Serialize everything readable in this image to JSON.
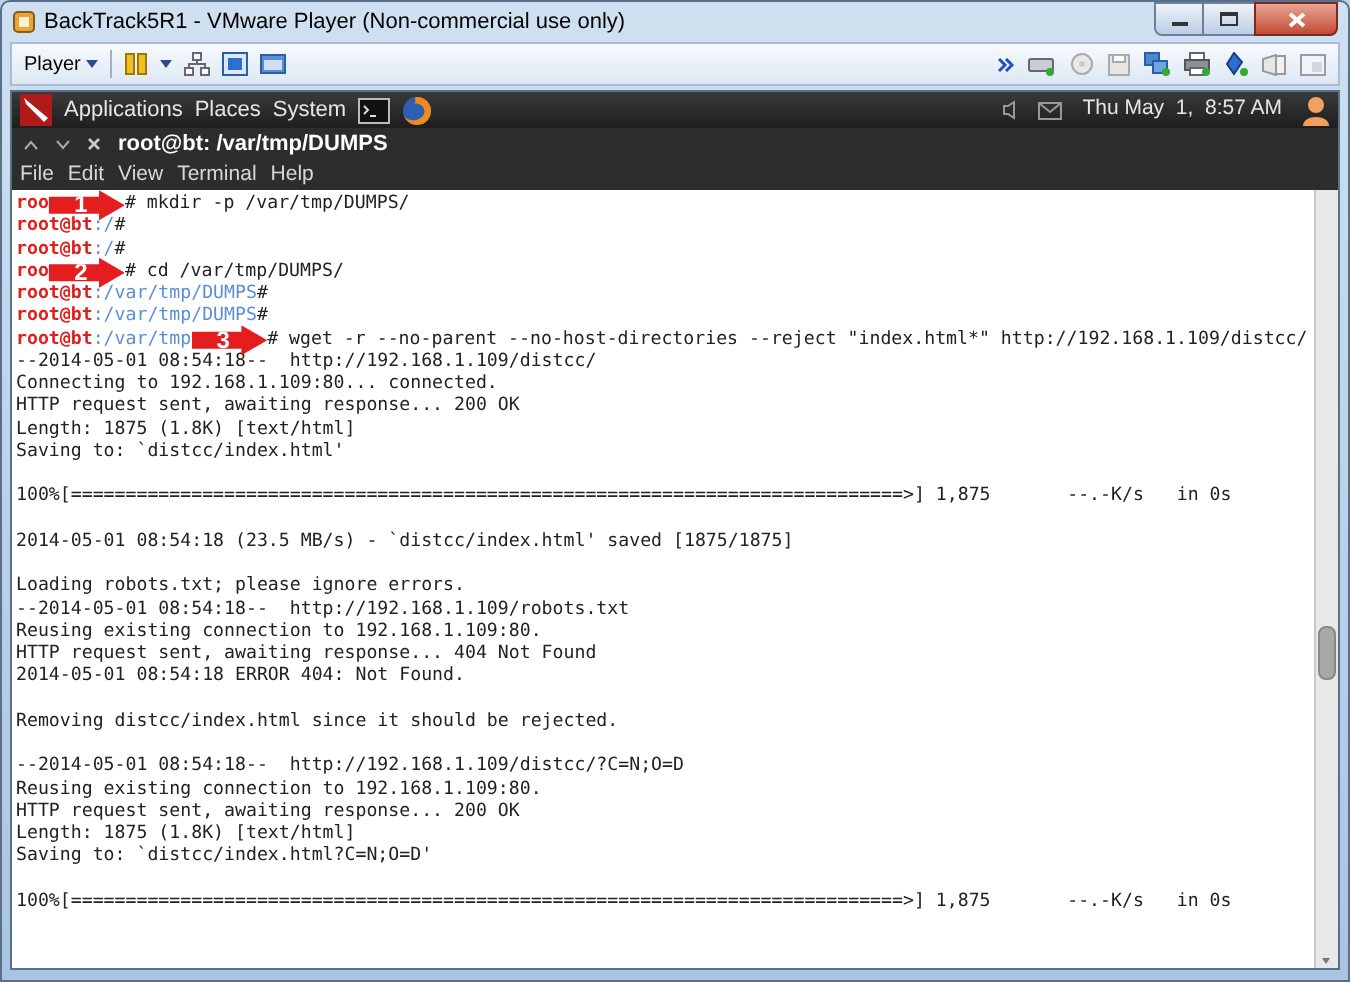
{
  "window": {
    "title": "BackTrack5R1 - VMware Player (Non-commercial use only)"
  },
  "toolbar": {
    "player_menu": "Player"
  },
  "panel": {
    "menus": [
      "Applications",
      "Places",
      "System"
    ],
    "clock": "Thu May  1,  8:57 AM"
  },
  "terminal": {
    "title": "root@bt: /var/tmp/DUMPS",
    "menu": [
      "File",
      "Edit",
      "View",
      "Terminal",
      "Help"
    ],
    "lines": [
      {
        "kind": "prompt",
        "segments": [
          {
            "kind": "user",
            "text": "roo"
          },
          {
            "kind": "arrow",
            "text": "1"
          },
          {
            "kind": "text",
            "text": "# mkdir -p /var/tmp/DUMPS/"
          }
        ]
      },
      {
        "kind": "prompt",
        "segments": [
          {
            "kind": "user",
            "text": "root@bt"
          },
          {
            "kind": "path",
            "text": ":/"
          },
          {
            "kind": "text",
            "text": "#"
          }
        ]
      },
      {
        "kind": "prompt",
        "segments": [
          {
            "kind": "user",
            "text": "root@bt"
          },
          {
            "kind": "path",
            "text": ":/"
          },
          {
            "kind": "text",
            "text": "#"
          }
        ]
      },
      {
        "kind": "prompt",
        "segments": [
          {
            "kind": "user",
            "text": "roo"
          },
          {
            "kind": "arrow",
            "text": "2"
          },
          {
            "kind": "text",
            "text": "# cd /var/tmp/DUMPS/"
          }
        ]
      },
      {
        "kind": "prompt",
        "segments": [
          {
            "kind": "user",
            "text": "root@bt"
          },
          {
            "kind": "path",
            "text": ":/var/tmp/DUMPS"
          },
          {
            "kind": "text",
            "text": "#"
          }
        ]
      },
      {
        "kind": "prompt",
        "segments": [
          {
            "kind": "user",
            "text": "root@bt"
          },
          {
            "kind": "path",
            "text": ":/var/tmp/DUMPS"
          },
          {
            "kind": "text",
            "text": "#"
          }
        ]
      },
      {
        "kind": "prompt",
        "segments": [
          {
            "kind": "user",
            "text": "root@bt"
          },
          {
            "kind": "path",
            "text": ":/var/tmp"
          },
          {
            "kind": "arrow",
            "text": "3"
          },
          {
            "kind": "text",
            "text": "# wget -r --no-parent --no-host-directories --reject \"index.html*\" http://192.168.1.109/distcc/"
          }
        ]
      },
      {
        "kind": "output",
        "text": "--2014-05-01 08:54:18--  http://192.168.1.109/distcc/"
      },
      {
        "kind": "output",
        "text": "Connecting to 192.168.1.109:80... connected."
      },
      {
        "kind": "output",
        "text": "HTTP request sent, awaiting response... 200 OK"
      },
      {
        "kind": "output",
        "text": "Length: 1875 (1.8K) [text/html]"
      },
      {
        "kind": "output",
        "text": "Saving to: `distcc/index.html'"
      },
      {
        "kind": "blank"
      },
      {
        "kind": "output",
        "text": "100%[============================================================================>] 1,875       --.-K/s   in 0s"
      },
      {
        "kind": "blank"
      },
      {
        "kind": "output",
        "text": "2014-05-01 08:54:18 (23.5 MB/s) - `distcc/index.html' saved [1875/1875]"
      },
      {
        "kind": "blank"
      },
      {
        "kind": "output",
        "text": "Loading robots.txt; please ignore errors."
      },
      {
        "kind": "output",
        "text": "--2014-05-01 08:54:18--  http://192.168.1.109/robots.txt"
      },
      {
        "kind": "output",
        "text": "Reusing existing connection to 192.168.1.109:80."
      },
      {
        "kind": "output",
        "text": "HTTP request sent, awaiting response... 404 Not Found"
      },
      {
        "kind": "output",
        "text": "2014-05-01 08:54:18 ERROR 404: Not Found."
      },
      {
        "kind": "blank"
      },
      {
        "kind": "output",
        "text": "Removing distcc/index.html since it should be rejected."
      },
      {
        "kind": "blank"
      },
      {
        "kind": "output",
        "text": "--2014-05-01 08:54:18--  http://192.168.1.109/distcc/?C=N;O=D"
      },
      {
        "kind": "output",
        "text": "Reusing existing connection to 192.168.1.109:80."
      },
      {
        "kind": "output",
        "text": "HTTP request sent, awaiting response... 200 OK"
      },
      {
        "kind": "output",
        "text": "Length: 1875 (1.8K) [text/html]"
      },
      {
        "kind": "output",
        "text": "Saving to: `distcc/index.html?C=N;O=D'"
      },
      {
        "kind": "blank"
      },
      {
        "kind": "output",
        "text": "100%[============================================================================>] 1,875       --.-K/s   in 0s"
      }
    ]
  }
}
